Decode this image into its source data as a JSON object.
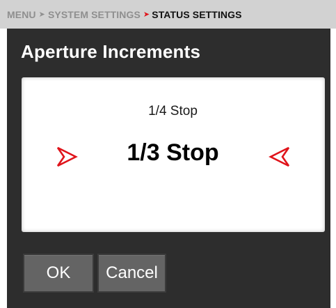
{
  "breadcrumb": {
    "items": [
      "MENU",
      "SYSTEM SETTINGS",
      "STATUS SETTINGS"
    ],
    "separator": "➤"
  },
  "dialog": {
    "title": "Aperture Increments",
    "previous_option": "1/4 Stop",
    "selected_option": "1/3 Stop",
    "left_arrow_icon": "red-arrow-right-icon",
    "right_arrow_icon": "red-arrow-left-icon"
  },
  "buttons": {
    "ok_label": "OK",
    "cancel_label": "Cancel"
  },
  "colors": {
    "accent_red": "#e0141b",
    "panel_bg": "#2d2d2d",
    "breadcrumb_bg": "#d2d2d2",
    "button_bg": "#646464"
  }
}
